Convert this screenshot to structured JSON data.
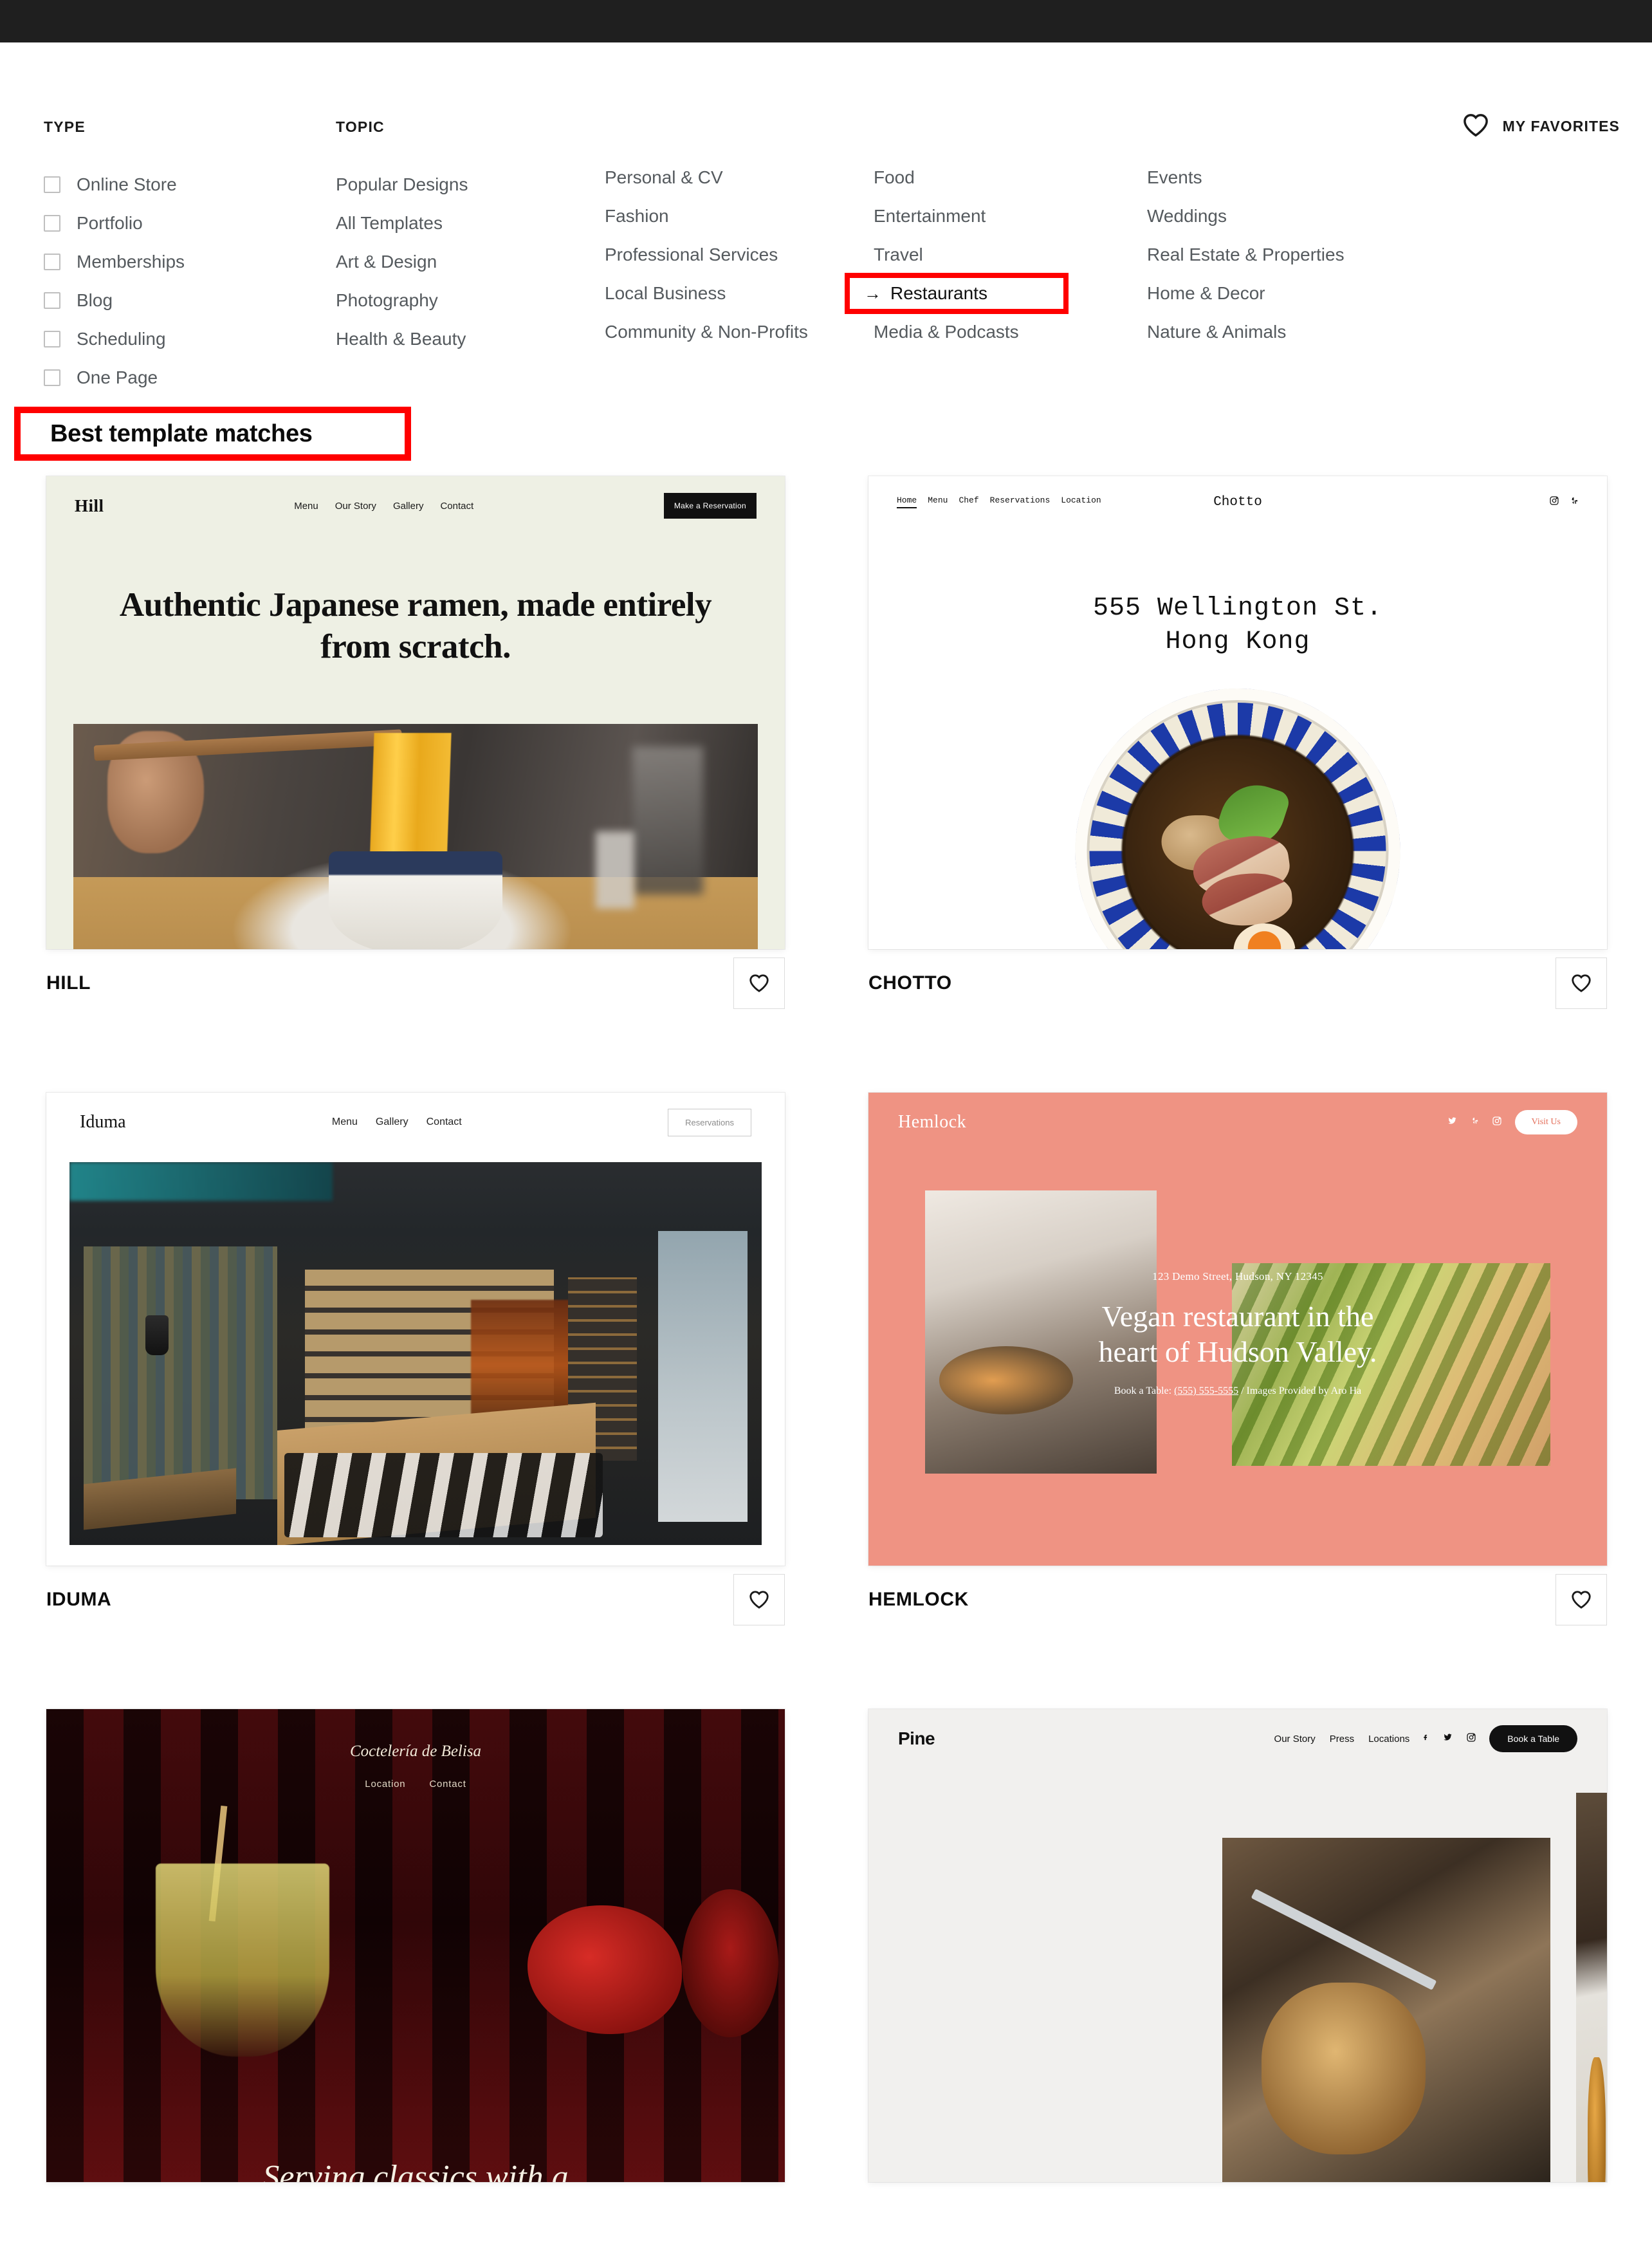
{
  "filters": {
    "type": {
      "heading": "TYPE",
      "items": [
        {
          "label": "Online Store",
          "checked": false
        },
        {
          "label": "Portfolio",
          "checked": false
        },
        {
          "label": "Memberships",
          "checked": false
        },
        {
          "label": "Blog",
          "checked": false
        },
        {
          "label": "Scheduling",
          "checked": false
        },
        {
          "label": "One Page",
          "checked": false
        }
      ]
    },
    "topic": {
      "heading": "TOPIC",
      "col1": [
        "Popular Designs",
        "All Templates",
        "Art & Design",
        "Photography",
        "Health & Beauty"
      ],
      "col2": [
        "Personal & CV",
        "Fashion",
        "Professional Services",
        "Local Business",
        "Community & Non-Profits"
      ],
      "col3": [
        "Food",
        "Entertainment",
        "Travel",
        "Restaurants",
        "Media & Podcasts"
      ],
      "col4": [
        "Events",
        "Weddings",
        "Real Estate & Properties",
        "Home & Decor",
        "Nature & Animals"
      ]
    },
    "highlighted_topic": {
      "label": "Restaurants",
      "arrow": "→",
      "outline_color": "#ff0000"
    }
  },
  "favorites": {
    "label": "MY FAVORITES",
    "icon": "heart-icon"
  },
  "section": {
    "heading": "Best template matches",
    "outline_color": "#ff0000"
  },
  "templates": [
    {
      "name": "HILL",
      "favorited": false,
      "preview": {
        "logo": "Hill",
        "nav": [
          "Menu",
          "Our Story",
          "Gallery",
          "Contact"
        ],
        "cta": "Make a Reservation",
        "headline": "Authentic Japanese ramen, made entirely from scratch.",
        "bg_color": "#eef0e4"
      }
    },
    {
      "name": "CHOTTO",
      "favorited": false,
      "preview": {
        "logo": "Chotto",
        "nav": [
          "Home",
          "Menu",
          "Chef",
          "Reservations",
          "Location"
        ],
        "headline_line1": "555 Wellington St.",
        "headline_line2": "Hong Kong",
        "social": [
          "instagram-icon",
          "yelp-icon"
        ],
        "bg_color": "#ffffff"
      }
    },
    {
      "name": "IDUMA",
      "favorited": false,
      "preview": {
        "logo": "Iduma",
        "nav": [
          "Menu",
          "Gallery",
          "Contact"
        ],
        "cta": "Reservations",
        "bg_color": "#ffffff"
      }
    },
    {
      "name": "HEMLOCK",
      "favorited": false,
      "preview": {
        "logo": "Hemlock",
        "cta": "Visit Us",
        "social": [
          "twitter-icon",
          "yelp-icon",
          "instagram-icon"
        ],
        "address": "123 Demo Street, Hudson, NY 12345",
        "headline_line1": "Vegan restaurant in the",
        "headline_line2": "heart of Hudson Valley.",
        "footer_prefix": "Book a Table:",
        "footer_phone": "(555) 555-5555",
        "footer_sep": "/",
        "footer_credit": "Images Provided by Aro Ha",
        "bg_color": "#ef9383"
      }
    },
    {
      "name": "",
      "favorited": false,
      "preview": {
        "logo": "Coctelería de Belisa",
        "nav": [
          "Location",
          "Contact"
        ],
        "headline": "Serving classics with a",
        "bg_color": "#2a0608"
      }
    },
    {
      "name": "",
      "favorited": false,
      "preview": {
        "logo": "Pine",
        "nav": [
          "Our Story",
          "Press",
          "Locations"
        ],
        "social": [
          "facebook-icon",
          "twitter-icon",
          "instagram-icon"
        ],
        "cta": "Book a Table",
        "bg_color": "#f1f0ee"
      }
    }
  ]
}
